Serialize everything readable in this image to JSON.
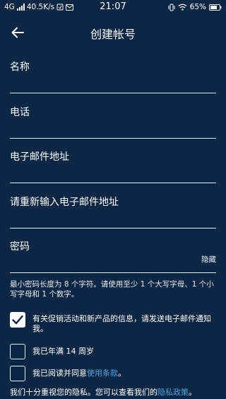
{
  "status_bar": {
    "network": "4G",
    "speed": "40.5K/s",
    "time": "21:07",
    "battery": "65%"
  },
  "header": {
    "title": "创建帐号"
  },
  "form": {
    "name_label": "名称",
    "phone_label": "电话",
    "email_label": "电子邮件地址",
    "email_confirm_label": "请重新输入电子邮件地址",
    "password_label": "密码",
    "password_toggle": "隐藏",
    "password_hint": "最小密码长度为 8 个字符。请使用至少 1 个大写字母、1 个小写字母和 1 个数字。"
  },
  "checks": {
    "promo": {
      "text": "有关促销活动和新产品的信息，请发送电子邮件通知我。",
      "checked": true
    },
    "age": {
      "text": "我已年满 14 周岁",
      "checked": false
    },
    "terms": {
      "text_prefix": "我已阅读并同意",
      "link": "使用条款",
      "text_suffix": "。",
      "checked": false
    }
  },
  "privacy": {
    "text_prefix": "我们十分重视您的隐私。您可以查看我们的",
    "link": "隐私政策",
    "text_suffix": "。"
  },
  "colors": {
    "background": "#0b2744",
    "link": "#4aa3e0",
    "text": "#ffffff"
  }
}
